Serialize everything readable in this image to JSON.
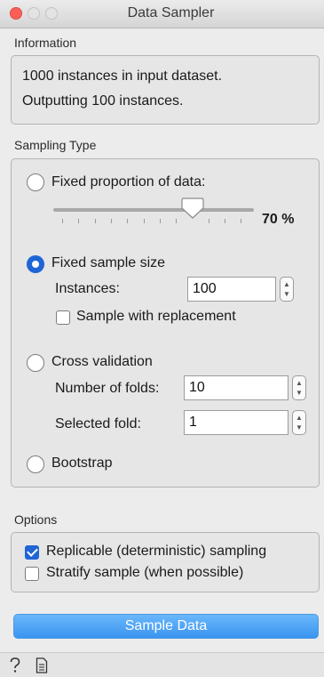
{
  "window": {
    "title": "Data Sampler"
  },
  "information": {
    "label": "Information",
    "lines": [
      "1000 instances in input dataset.",
      "Outputting 100 instances."
    ]
  },
  "sampling": {
    "label": "Sampling Type",
    "fixed_proportion": {
      "label": "Fixed proportion of data:",
      "selected": false,
      "value_text": "70 %",
      "value_fraction": 0.7
    },
    "fixed_size": {
      "label": "Fixed sample size",
      "selected": true,
      "instances_label": "Instances:",
      "instances_value": "100",
      "replacement_label": "Sample with replacement",
      "replacement_checked": false
    },
    "cross_validation": {
      "label": "Cross validation",
      "selected": false,
      "folds_label": "Number of folds:",
      "folds_value": "10",
      "selected_fold_label": "Selected fold:",
      "selected_fold_value": "1"
    },
    "bootstrap": {
      "label": "Bootstrap",
      "selected": false
    }
  },
  "options": {
    "label": "Options",
    "replicable_label": "Replicable (deterministic) sampling",
    "replicable_checked": true,
    "stratify_label": "Stratify sample (when possible)",
    "stratify_checked": false
  },
  "actions": {
    "sample_button": "Sample Data"
  },
  "statusbar": {
    "help_icon": "question-mark-icon",
    "report_icon": "document-icon"
  },
  "colors": {
    "accent": "#1f65d6",
    "button": "#3a94f0",
    "close": "#fc5f57"
  }
}
